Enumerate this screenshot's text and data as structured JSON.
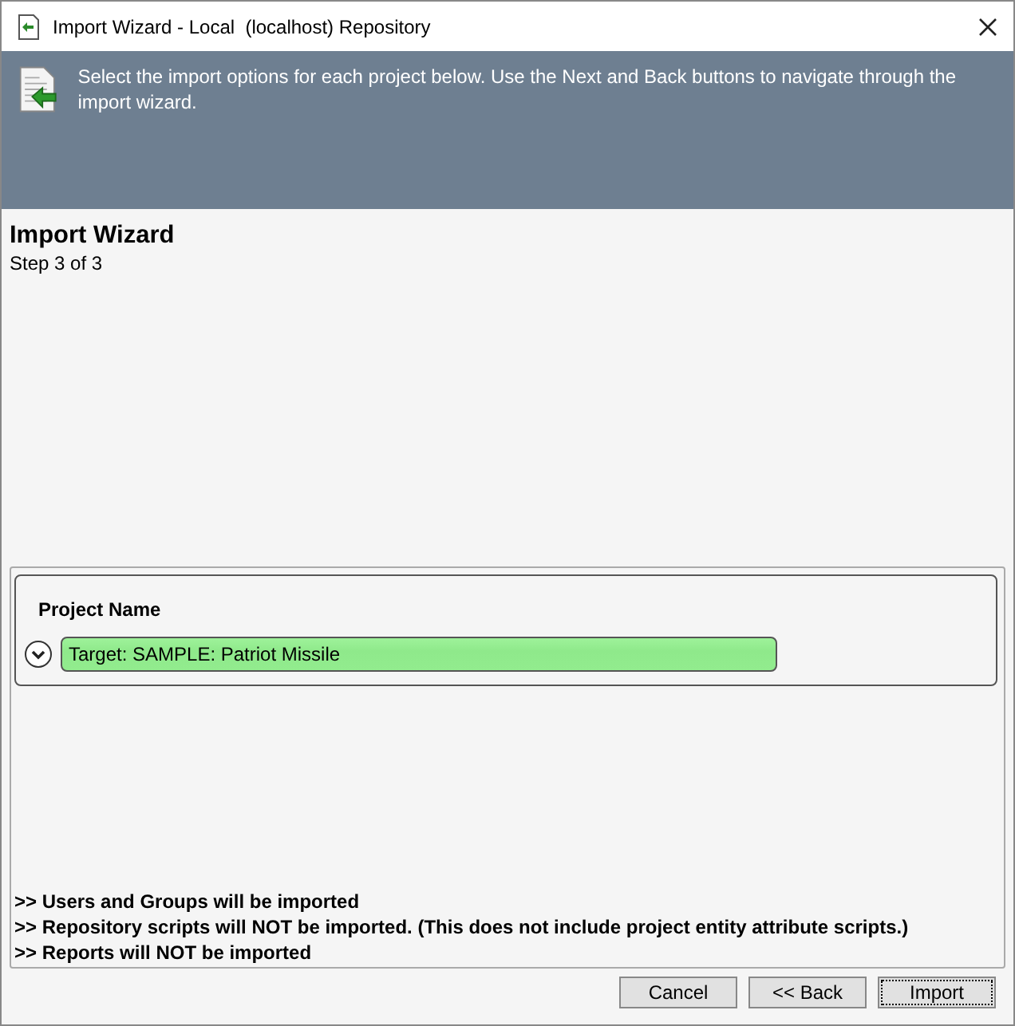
{
  "window": {
    "title": "Import Wizard - Local  (localhost) Repository"
  },
  "header": {
    "text": "Select the import options for each project below. Use the Next and Back buttons to navigate through the import wizard."
  },
  "wizard": {
    "title": "Import Wizard",
    "step": "Step 3 of 3"
  },
  "projects": {
    "column": "Project Name",
    "items": [
      {
        "name": "Target: SAMPLE: Patriot Missile",
        "expanded": false
      }
    ]
  },
  "notes": [
    ">> Users and Groups will be imported",
    ">> Repository scripts will NOT be imported. (This does not include project entity attribute scripts.)",
    ">> Reports will NOT be imported"
  ],
  "buttons": [
    {
      "label": "Cancel",
      "focused": false
    },
    {
      "label": "<< Back",
      "focused": false
    },
    {
      "label": "Import",
      "focused": true
    }
  ]
}
